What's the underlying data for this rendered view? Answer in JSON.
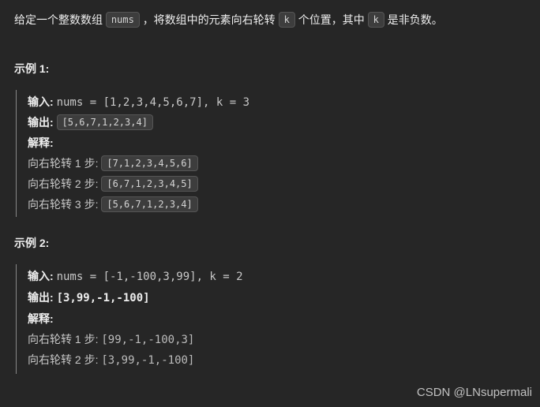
{
  "intro": {
    "seg1": "给定一个整数数组 ",
    "chip1": "nums",
    "seg2": "，将数组中的元素向右轮转 ",
    "chip2": "k",
    "seg3": " 个位置，其中 ",
    "chip3": "k",
    "seg4": " 是非负数。"
  },
  "examples": [
    {
      "title": "示例 1:",
      "input_label": "输入:",
      "input_value": "nums = [1,2,3,4,5,6,7], k = 3",
      "output_label": "输出:",
      "output_value": "[5,6,7,1,2,3,4]",
      "explain_label": "解释:",
      "steps": [
        {
          "text": "向右轮转 1 步: ",
          "value": "[7,1,2,3,4,5,6]",
          "chip": true
        },
        {
          "text": "向右轮转 2 步: ",
          "value": "[6,7,1,2,3,4,5]",
          "chip": true
        },
        {
          "text": "向右轮转 3 步: ",
          "value": "[5,6,7,1,2,3,4]",
          "chip": true
        }
      ],
      "output_chip": true
    },
    {
      "title": "示例 2:",
      "input_label": "输入:",
      "input_value": "nums = [-1,-100,3,99], k = 2",
      "output_label": "输出:",
      "output_value": "[3,99,-1,-100]",
      "explain_label": "解释: ",
      "steps": [
        {
          "text": "向右轮转 1 步: ",
          "value": "[99,-1,-100,3]",
          "chip": false
        },
        {
          "text": "向右轮转 2 步: ",
          "value": "[3,99,-1,-100]",
          "chip": false
        }
      ],
      "output_chip": false
    }
  ],
  "watermark": "CSDN @LNsupermali"
}
